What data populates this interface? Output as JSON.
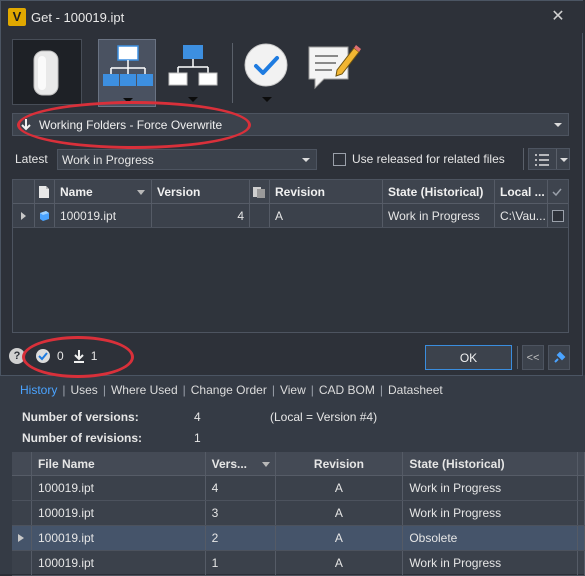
{
  "dialog": {
    "title": "Get - 100019.ipt",
    "app_icon_text": "V",
    "close_label": "✕"
  },
  "toolbar": {
    "buttons": [
      "file-thumbnail",
      "structure-tree-children",
      "structure-tree-parents",
      "check-button",
      "comment-edit-icon"
    ]
  },
  "download_mode": {
    "value": "Working Folders - Force Overwrite"
  },
  "version_filter": {
    "label": "Latest",
    "value": "Work in Progress",
    "checkbox_label": "Use released for related files"
  },
  "file_grid": {
    "headers": {
      "name": "Name",
      "version": "Version",
      "revision": "Revision",
      "state": "State (Historical)",
      "local": "Local ..."
    },
    "rows": [
      {
        "name": "100019.ipt",
        "version": "4",
        "revision": "A",
        "state": "Work in Progress",
        "local": "C:\\Vau..."
      }
    ]
  },
  "status": {
    "checked_count": "0",
    "download_count": "1",
    "help_label": "?"
  },
  "buttons": {
    "ok_label": "OK",
    "collapse_label": "<<"
  },
  "background": {
    "tabs": [
      "History",
      "Uses",
      "Where Used",
      "Change Order",
      "View",
      "CAD BOM",
      "Datasheet"
    ],
    "summary": {
      "versions_label": "Number of versions:",
      "versions_value": "4",
      "local_note": "(Local = Version #4)",
      "revisions_label": "Number of revisions:",
      "revisions_value": "1"
    },
    "history_grid": {
      "headers": {
        "file": "File Name",
        "version": "Vers...",
        "revision": "Revision",
        "state": "State (Historical)"
      },
      "rows": [
        {
          "file": "100019.ipt",
          "version": "4",
          "revision": "A",
          "state": "Work in Progress"
        },
        {
          "file": "100019.ipt",
          "version": "3",
          "revision": "A",
          "state": "Work in Progress"
        },
        {
          "file": "100019.ipt",
          "version": "2",
          "revision": "A",
          "state": "Obsolete"
        },
        {
          "file": "100019.ipt",
          "version": "1",
          "revision": "A",
          "state": "Work in Progress"
        }
      ]
    }
  },
  "colors": {
    "accent_blue": "#3a8dde",
    "annotation_red": "#d9303a",
    "check_blue": "#1e7be0"
  }
}
